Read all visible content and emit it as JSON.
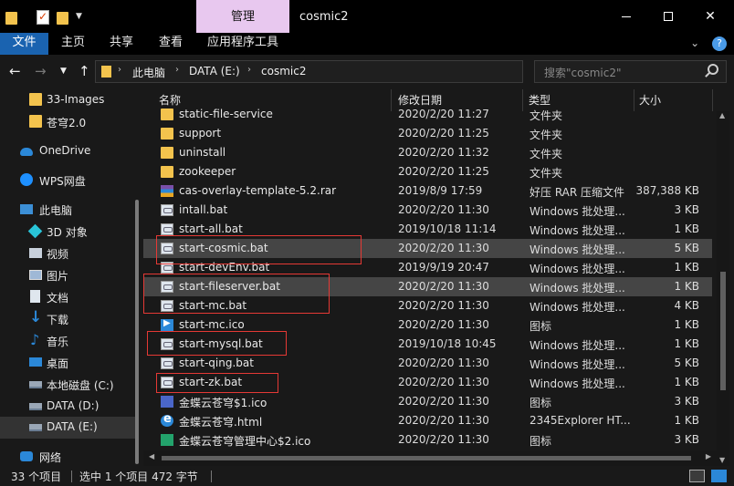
{
  "titlebar": {
    "manage_tab": "管理",
    "window_title": "cosmic2"
  },
  "ribbon": {
    "tabs": [
      "文件",
      "主页",
      "共享",
      "查看",
      "应用程序工具"
    ],
    "collapse_glyph": "⌄",
    "help_glyph": "?"
  },
  "nav": {
    "back_glyph": "←",
    "forward_glyph": "→",
    "up_glyph": "↑",
    "breadcrumb": [
      "此电脑",
      "DATA (E:)",
      "cosmic2"
    ],
    "search_placeholder": "搜索\"cosmic2\""
  },
  "sidebar": {
    "items": [
      {
        "label": "33-Images",
        "icon": "folder-icon"
      },
      {
        "label": "苍穹2.0",
        "icon": "folder-icon"
      },
      {
        "label": "OneDrive",
        "icon": "onedrive-icon"
      },
      {
        "label": "WPS网盘",
        "icon": "wps-cloud-icon"
      },
      {
        "label": "此电脑",
        "icon": "this-pc-icon"
      },
      {
        "label": "3D 对象",
        "icon": "3d-objects-icon"
      },
      {
        "label": "视频",
        "icon": "videos-icon"
      },
      {
        "label": "图片",
        "icon": "pictures-icon"
      },
      {
        "label": "文档",
        "icon": "documents-icon"
      },
      {
        "label": "下载",
        "icon": "downloads-icon"
      },
      {
        "label": "音乐",
        "icon": "music-icon"
      },
      {
        "label": "桌面",
        "icon": "desktop-icon"
      },
      {
        "label": "本地磁盘 (C:)",
        "icon": "drive-icon"
      },
      {
        "label": "DATA (D:)",
        "icon": "drive-icon"
      },
      {
        "label": "DATA (E:)",
        "icon": "drive-icon",
        "selected": true
      },
      {
        "label": "网络",
        "icon": "network-icon"
      }
    ]
  },
  "columns": {
    "name": "名称",
    "date": "修改日期",
    "type": "类型",
    "size": "大小"
  },
  "files": [
    {
      "name": "static-file-service",
      "date": "2020/2/20 11:27",
      "type": "文件夹",
      "size": "",
      "kind": "folder"
    },
    {
      "name": "support",
      "date": "2020/2/20 11:25",
      "type": "文件夹",
      "size": "",
      "kind": "folder"
    },
    {
      "name": "uninstall",
      "date": "2020/2/20 11:32",
      "type": "文件夹",
      "size": "",
      "kind": "folder"
    },
    {
      "name": "zookeeper",
      "date": "2020/2/20 11:25",
      "type": "文件夹",
      "size": "",
      "kind": "folder"
    },
    {
      "name": "cas-overlay-template-5.2.rar",
      "date": "2019/8/9 17:59",
      "type": "好压 RAR 压缩文件",
      "size": "387,388 KB",
      "kind": "rar"
    },
    {
      "name": "intall.bat",
      "date": "2020/2/20 11:30",
      "type": "Windows 批处理...",
      "size": "3 KB",
      "kind": "bat"
    },
    {
      "name": "start-all.bat",
      "date": "2019/10/18 11:14",
      "type": "Windows 批处理...",
      "size": "1 KB",
      "kind": "bat"
    },
    {
      "name": "start-cosmic.bat",
      "date": "2020/2/20 11:30",
      "type": "Windows 批处理...",
      "size": "5 KB",
      "kind": "bat",
      "selected": true
    },
    {
      "name": "start-devEnv.bat",
      "date": "2019/9/19 20:47",
      "type": "Windows 批处理...",
      "size": "1 KB",
      "kind": "bat"
    },
    {
      "name": "start-fileserver.bat",
      "date": "2020/2/20 11:30",
      "type": "Windows 批处理...",
      "size": "1 KB",
      "kind": "bat",
      "hovered": true
    },
    {
      "name": "start-mc.bat",
      "date": "2020/2/20 11:30",
      "type": "Windows 批处理...",
      "size": "4 KB",
      "kind": "bat"
    },
    {
      "name": "start-mc.ico",
      "date": "2020/2/20 11:30",
      "type": "图标",
      "size": "1 KB",
      "kind": "ico"
    },
    {
      "name": "start-mysql.bat",
      "date": "2019/10/18 10:45",
      "type": "Windows 批处理...",
      "size": "1 KB",
      "kind": "bat"
    },
    {
      "name": "start-qing.bat",
      "date": "2020/2/20 11:30",
      "type": "Windows 批处理...",
      "size": "5 KB",
      "kind": "bat"
    },
    {
      "name": "start-zk.bat",
      "date": "2020/2/20 11:30",
      "type": "Windows 批处理...",
      "size": "1 KB",
      "kind": "bat"
    },
    {
      "name": "金蝶云苍穹$1.ico",
      "date": "2020/2/20 11:30",
      "type": "图标",
      "size": "3 KB",
      "kind": "kd1"
    },
    {
      "name": "金蝶云苍穹.html",
      "date": "2020/2/20 11:30",
      "type": "2345Explorer HT...",
      "size": "1 KB",
      "kind": "html"
    },
    {
      "name": "金蝶云苍穹管理中心$2.ico",
      "date": "2020/2/20 11:30",
      "type": "图标",
      "size": "3 KB",
      "kind": "kd2"
    }
  ],
  "status": {
    "count": "33 个项目",
    "selection": "选中 1 个项目  472 字节"
  },
  "colors": {
    "accent": "#1a63b0",
    "manage_tab": "#e8c8ef",
    "annotation_box": "#e53935"
  }
}
